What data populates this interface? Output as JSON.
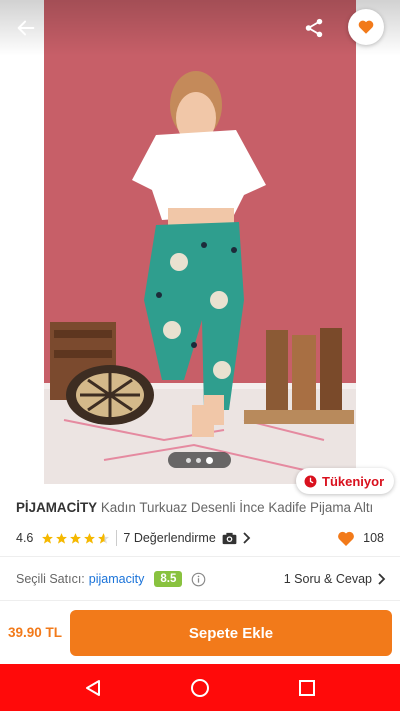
{
  "icons": {
    "back": "arrow-left-icon",
    "share": "share-icon",
    "favorite": "heart-icon",
    "stock": "clock-icon",
    "star": "star-icon",
    "camera": "camera-icon",
    "chevron": "chevron-right-icon",
    "info": "info-icon",
    "nav_back": "triangle-back-icon",
    "nav_home": "circle-home-icon",
    "nav_recents": "square-recents-icon"
  },
  "colors": {
    "accent": "#f27a1a",
    "stock_red": "#d9111e",
    "seller_link": "#1a73d9",
    "score_green": "#89c23f",
    "navbar": "#ff0a0a"
  },
  "gallery": {
    "image_count": 3,
    "active_index": 2
  },
  "stock_badge": {
    "label": "Tükeniyor"
  },
  "product": {
    "brand": "PİJAMACİTY",
    "name": "Kadın Turkuaz Desenli İnce Kadife Pijama Altı"
  },
  "rating": {
    "score": "4.6",
    "stars": 4.6,
    "reviews_label": "7 Değerlendirme",
    "likes": "108"
  },
  "seller": {
    "label": "Seçili Satıcı:",
    "name": "pijamacity",
    "score": "8.5",
    "qa_label": "1 Soru & Cevap"
  },
  "purchase": {
    "price": "39.90 TL",
    "cart_label": "Sepete Ekle"
  }
}
